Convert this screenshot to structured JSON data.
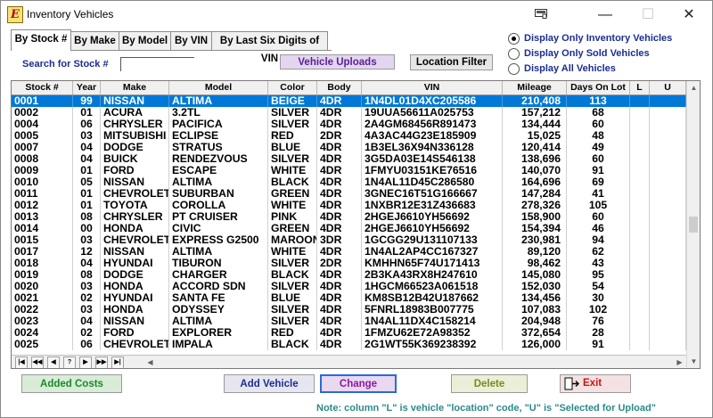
{
  "window": {
    "title": "Inventory Vehicles",
    "app_icon": "E"
  },
  "tabs": [
    {
      "label": "By Stock #"
    },
    {
      "label": "By Make"
    },
    {
      "label": "By Model"
    },
    {
      "label": "By VIN"
    },
    {
      "label": "By Last Six Digits of VIN"
    }
  ],
  "search": {
    "label": "Search for Stock #",
    "value": ""
  },
  "buttons": {
    "vehicle_uploads": "Vehicle Uploads",
    "location_filter": "Location Filter",
    "added_costs": "Added Costs",
    "add_vehicle": "Add Vehicle",
    "change": "Change",
    "delete": "Delete",
    "exit": "Exit"
  },
  "radio_options": [
    {
      "label": "Display Only Inventory Vehicles",
      "selected": true
    },
    {
      "label": "Display Only Sold Vehicles",
      "selected": false
    },
    {
      "label": "Display All Vehicles",
      "selected": false
    }
  ],
  "columns": [
    "Stock #",
    "Year",
    "Make",
    "Model",
    "Color",
    "Body",
    "VIN",
    "Mileage",
    "Days On Lot",
    "L",
    "U"
  ],
  "rows": [
    [
      "0001",
      "99",
      "NISSAN",
      "ALTIMA",
      "BEIGE",
      "4DR",
      "1N4DL01D4XC205586",
      "210,408",
      "113",
      "",
      ""
    ],
    [
      "0002",
      "01",
      "ACURA",
      "3.2TL",
      "SILVER",
      "4DR",
      "19UUA56611A025753",
      "157,212",
      "68",
      "",
      ""
    ],
    [
      "0004",
      "06",
      "CHRYSLER",
      "PACIFICA",
      "SILVER",
      "4DR",
      "2A4GM68456R891473",
      "134,444",
      "60",
      "",
      ""
    ],
    [
      "0005",
      "03",
      "MITSUBISHI",
      "ECLIPSE",
      "RED",
      "2DR",
      "4A3AC44G23E185909",
      "15,025",
      "48",
      "",
      ""
    ],
    [
      "0007",
      "04",
      "DODGE",
      "STRATUS",
      "BLUE",
      "4DR",
      "1B3EL36X94N336128",
      "120,414",
      "49",
      "",
      ""
    ],
    [
      "0008",
      "04",
      "BUICK",
      "RENDEZVOUS",
      "SILVER",
      "4DR",
      "3G5DA03E14S546138",
      "138,696",
      "60",
      "",
      ""
    ],
    [
      "0009",
      "01",
      "FORD",
      "ESCAPE",
      "WHITE",
      "4DR",
      "1FMYU03151KE76516",
      "140,070",
      "91",
      "",
      ""
    ],
    [
      "0010",
      "05",
      "NISSAN",
      "ALTIMA",
      "BLACK",
      "4DR",
      "1N4AL11D45C286580",
      "164,696",
      "69",
      "",
      ""
    ],
    [
      "0011",
      "01",
      "CHEVROLET",
      "SUBURBAN",
      "GREEN",
      "4DR",
      "3GNEC16T51G166667",
      "147,284",
      "41",
      "",
      ""
    ],
    [
      "0012",
      "01",
      "TOYOTA",
      "COROLLA",
      "WHITE",
      "4DR",
      "1NXBR12E31Z436683",
      "278,326",
      "105",
      "",
      ""
    ],
    [
      "0013",
      "08",
      "CHRYSLER",
      "PT CRUISER",
      "PINK",
      "4DR",
      "2HGEJ6610YH56692",
      "158,900",
      "60",
      "",
      ""
    ],
    [
      "0014",
      "00",
      "HONDA",
      "CIVIC",
      "GREEN",
      "4DR",
      "2HGEJ6610YH56692",
      "154,394",
      "46",
      "",
      ""
    ],
    [
      "0015",
      "03",
      "CHEVROLET",
      "EXPRESS G2500",
      "MAROON",
      "3DR",
      "1GCGG29U131107133",
      "230,981",
      "94",
      "",
      ""
    ],
    [
      "0017",
      "12",
      "NISSAN",
      "ALTIMA",
      "WHITE",
      "4DR",
      "1N4AL2AP4CC167327",
      "89,120",
      "62",
      "",
      ""
    ],
    [
      "0018",
      "04",
      "HYUNDAI",
      "TIBURON",
      "SILVER",
      "2DR",
      "KMHHN65F74U171413",
      "98,462",
      "43",
      "",
      ""
    ],
    [
      "0019",
      "08",
      "DODGE",
      "CHARGER",
      "BLACK",
      "4DR",
      "2B3KA43RX8H247610",
      "145,080",
      "95",
      "",
      ""
    ],
    [
      "0020",
      "03",
      "HONDA",
      "ACCORD SDN",
      "SILVER",
      "4DR",
      "1HGCM66523A061518",
      "152,030",
      "54",
      "",
      ""
    ],
    [
      "0021",
      "02",
      "HYUNDAI",
      "SANTA FE",
      "BLUE",
      "4DR",
      "KM8SB12B42U187662",
      "134,456",
      "30",
      "",
      ""
    ],
    [
      "0022",
      "03",
      "HONDA",
      "ODYSSEY",
      "SILVER",
      "4DR",
      "5FNRL18983B007775",
      "107,083",
      "102",
      "",
      ""
    ],
    [
      "0023",
      "04",
      "NISSAN",
      "ALTIMA",
      "SILVER",
      "4DR",
      "1N4AL11DX4C158214",
      "204,948",
      "76",
      "",
      ""
    ],
    [
      "0024",
      "02",
      "FORD",
      "EXPLORER",
      "RED",
      "4DR",
      "1FMZU62E72A98352",
      "372,654",
      "28",
      "",
      ""
    ],
    [
      "0025",
      "06",
      "CHEVROLET",
      "IMPALA",
      "BLACK",
      "4DR",
      "2G1WT55K369238392",
      "126,000",
      "91",
      "",
      ""
    ]
  ],
  "nav_buttons": [
    "|◀",
    "◀◀",
    "◀",
    "?",
    "▶",
    "▶▶",
    "▶|"
  ],
  "note": "Note: column \"L\" is vehicle \"location\" code, \"U\" is \"Selected for Upload\"",
  "colors": {
    "selection": "#0078d7",
    "label_blue": "#1c2d90",
    "added_costs_text": "#1a8a2a",
    "add_vehicle_text": "#1c2d90",
    "change_text": "#8a1aa0",
    "change_border": "#2a6ad8",
    "delete_text": "#7a8a20",
    "exit_text": "#d01010",
    "note_text": "#2a8a8a"
  }
}
